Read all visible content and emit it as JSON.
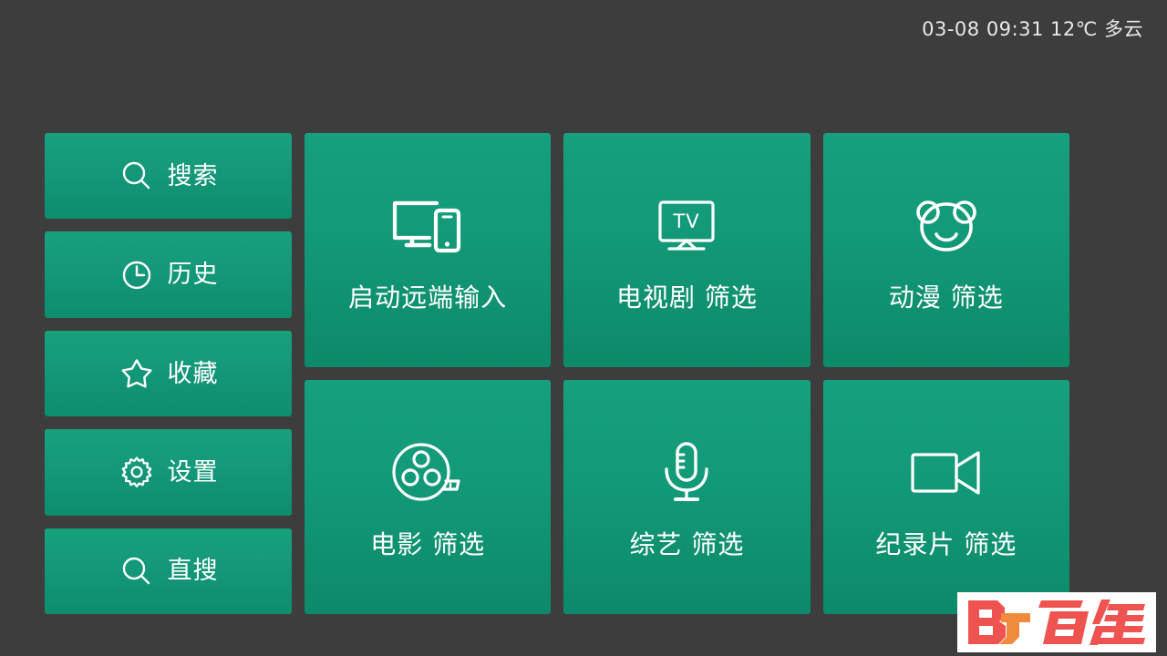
{
  "status_bar": {
    "text": "03-08 09:31  12℃ 多云",
    "date": "03-08",
    "time": "09:31",
    "temperature": "12℃",
    "weather": "多云"
  },
  "theme": {
    "background": "#3d3d3d",
    "tile_top": "#17a07e",
    "tile_bottom": "#0c8a69",
    "text": "#ffffff",
    "status_text": "#e9e9e9",
    "watermark_red": "#ef5350",
    "watermark_orange": "#f08a3c",
    "watermark_bg": "#ffffff"
  },
  "sidebar": {
    "items": [
      {
        "label": "搜索",
        "icon": "search-icon"
      },
      {
        "label": "历史",
        "icon": "clock-icon"
      },
      {
        "label": "收藏",
        "icon": "star-icon"
      },
      {
        "label": "设置",
        "icon": "gear-icon"
      },
      {
        "label": "直搜",
        "icon": "search-icon"
      }
    ]
  },
  "grid": {
    "tiles": [
      {
        "label": "启动远端输入",
        "icon": "monitor-phone-icon"
      },
      {
        "label": "电视剧 筛选",
        "icon": "tv-icon",
        "icon_text": "TV"
      },
      {
        "label": "动漫 筛选",
        "icon": "bear-face-icon"
      },
      {
        "label": "电影 筛选",
        "icon": "film-reel-icon"
      },
      {
        "label": "综艺 筛选",
        "icon": "microphone-icon"
      },
      {
        "label": "纪录片 筛选",
        "icon": "video-camera-icon"
      }
    ]
  },
  "watermark": {
    "mark": "BJ",
    "text": "百佳"
  }
}
